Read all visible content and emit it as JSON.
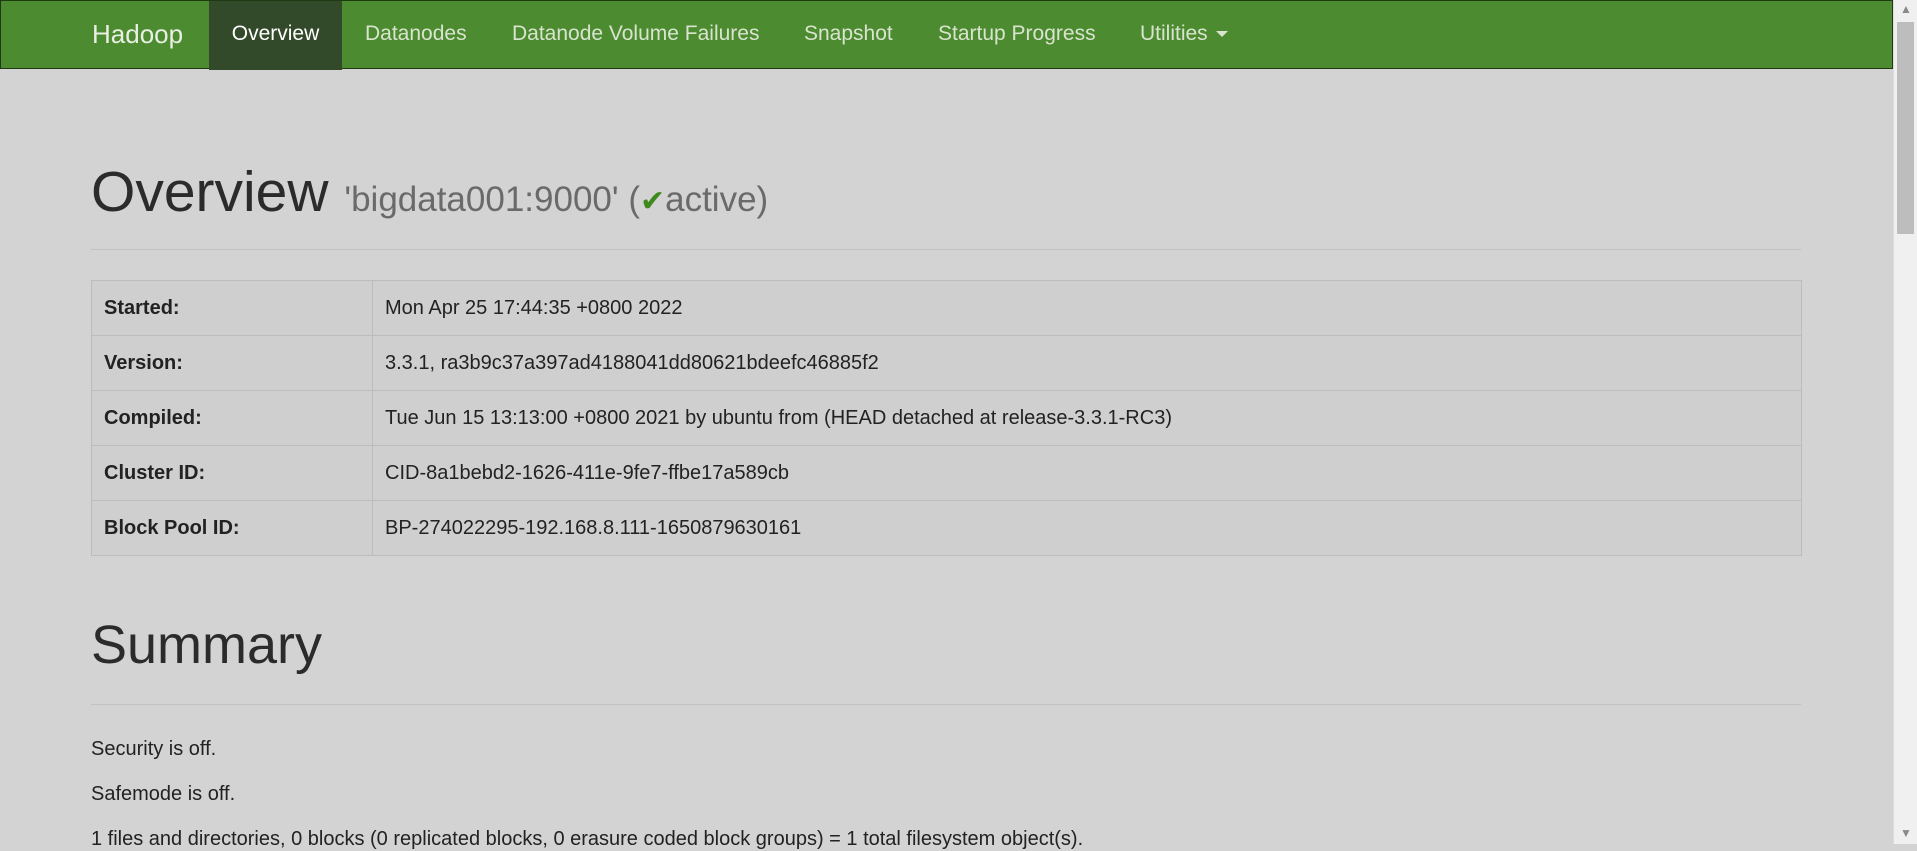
{
  "navbar": {
    "brand": "Hadoop",
    "items": [
      {
        "label": "Overview"
      },
      {
        "label": "Datanodes"
      },
      {
        "label": "Datanode Volume Failures"
      },
      {
        "label": "Snapshot"
      },
      {
        "label": "Startup Progress"
      },
      {
        "label": "Utilities"
      }
    ]
  },
  "header": {
    "title": "Overview",
    "host": "'bigdata001:9000'",
    "state_open": "(",
    "state": "active",
    "state_close": ")",
    "state_icon": "check-icon",
    "accent_color": "#4c8b2f"
  },
  "info_table": [
    {
      "label": "Started:",
      "value": "Mon Apr 25 17:44:35 +0800 2022"
    },
    {
      "label": "Version:",
      "value": "3.3.1, ra3b9c37a397ad4188041dd80621bdeefc46885f2"
    },
    {
      "label": "Compiled:",
      "value": "Tue Jun 15 13:13:00 +0800 2021 by ubuntu from (HEAD detached at release-3.3.1-RC3)"
    },
    {
      "label": "Cluster ID:",
      "value": "CID-8a1bebd2-1626-411e-9fe7-ffbe17a589cb"
    },
    {
      "label": "Block Pool ID:",
      "value": "BP-274022295-192.168.8.111-1650879630161"
    }
  ],
  "summary": {
    "title": "Summary",
    "security": "Security is off.",
    "safemode": "Safemode is off.",
    "files": "1 files and directories, 0 blocks (0 replicated blocks, 0 erasure coded block groups) = 1 total filesystem object(s)."
  }
}
